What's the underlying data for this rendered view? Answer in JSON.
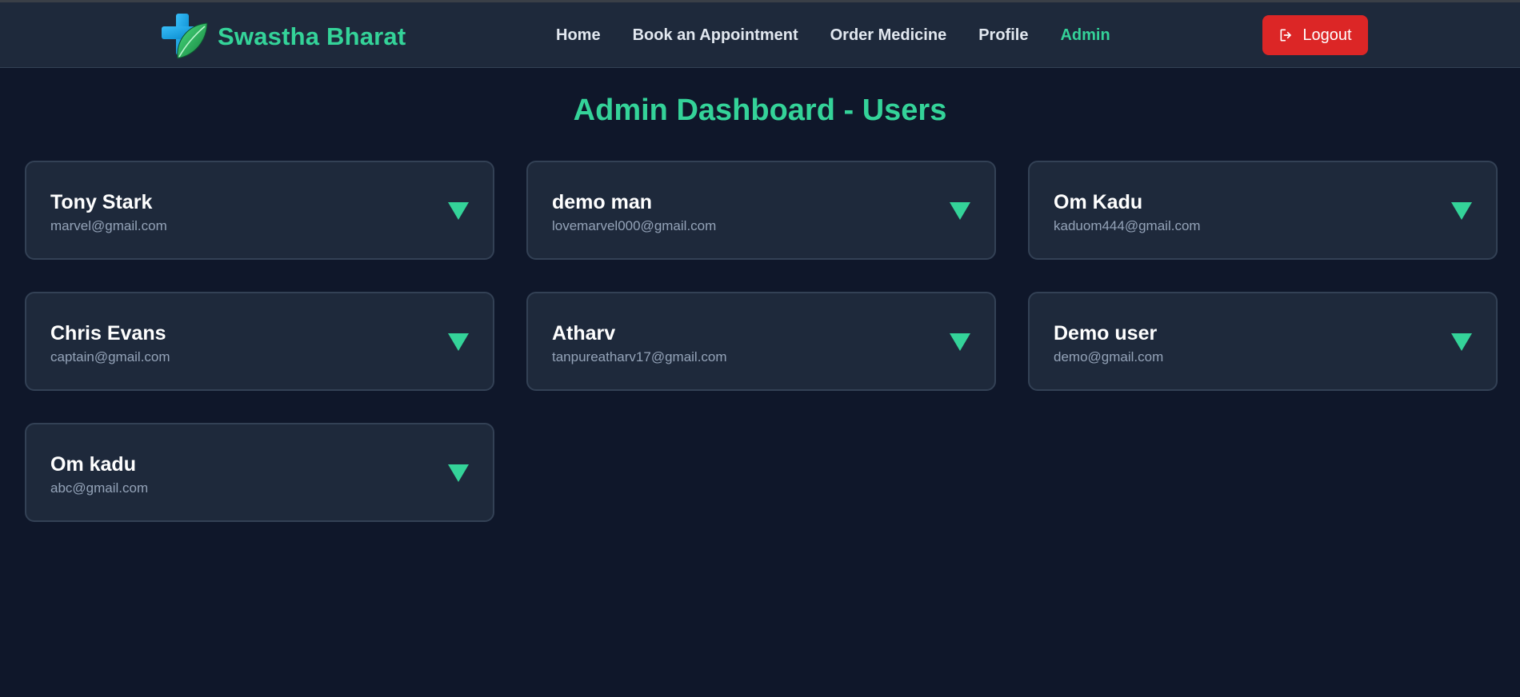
{
  "brand": {
    "name": "Swastha Bharat",
    "logo": "medical-cross-leaf-icon"
  },
  "nav": {
    "items": [
      {
        "label": "Home",
        "active": false
      },
      {
        "label": "Book an Appointment",
        "active": false
      },
      {
        "label": "Order Medicine",
        "active": false
      },
      {
        "label": "Profile",
        "active": false
      },
      {
        "label": "Admin",
        "active": true
      }
    ],
    "logout_label": "Logout",
    "logout_icon": "logout-icon"
  },
  "page": {
    "title": "Admin Dashboard - Users"
  },
  "users": [
    {
      "name": "Tony Stark",
      "email": "marvel@gmail.com"
    },
    {
      "name": "demo man",
      "email": "lovemarvel000@gmail.com"
    },
    {
      "name": "Om Kadu",
      "email": "kaduom444@gmail.com"
    },
    {
      "name": "Chris Evans",
      "email": "captain@gmail.com"
    },
    {
      "name": "Atharv",
      "email": "tanpureatharv17@gmail.com"
    },
    {
      "name": "Demo user",
      "email": "demo@gmail.com"
    },
    {
      "name": "Om kadu",
      "email": "abc@gmail.com"
    }
  ],
  "colors": {
    "accent": "#34d399",
    "background": "#0f172a",
    "surface": "#1e293b",
    "danger": "#dc2626"
  }
}
